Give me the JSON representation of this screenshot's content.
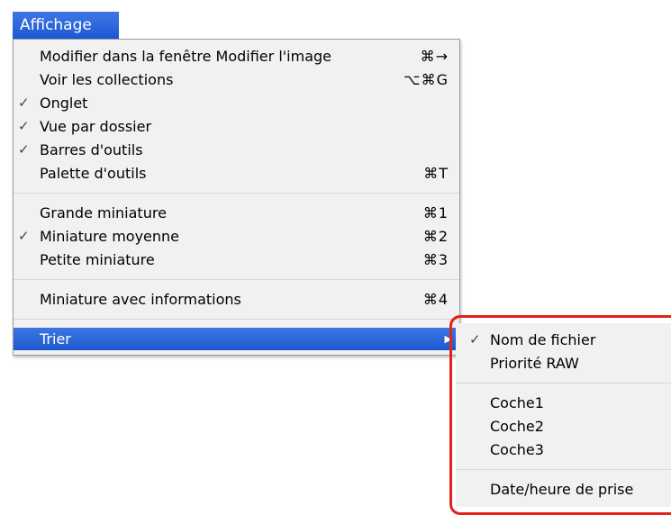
{
  "menu_title": "Affichage",
  "menu": {
    "items": [
      {
        "label": "Modifier dans la fenêtre Modifier l'image",
        "shortcut": "⌘→",
        "check": ""
      },
      {
        "label": "Voir les collections",
        "shortcut": "⌥⌘G",
        "check": ""
      },
      {
        "label": "Onglet",
        "shortcut": "",
        "check": "✓"
      },
      {
        "label": "Vue par dossier",
        "shortcut": "",
        "check": "✓"
      },
      {
        "label": "Barres d'outils",
        "shortcut": "",
        "check": "✓"
      },
      {
        "label": "Palette d'outils",
        "shortcut": "⌘T",
        "check": ""
      },
      {
        "label": "Grande miniature",
        "shortcut": "⌘1",
        "check": ""
      },
      {
        "label": "Miniature moyenne",
        "shortcut": "⌘2",
        "check": "✓"
      },
      {
        "label": "Petite miniature",
        "shortcut": "⌘3",
        "check": ""
      },
      {
        "label": "Miniature avec informations",
        "shortcut": "⌘4",
        "check": ""
      },
      {
        "label": "Trier",
        "shortcut": "▶",
        "check": ""
      }
    ]
  },
  "submenu": {
    "items": [
      {
        "label": "Nom de fichier",
        "check": "✓"
      },
      {
        "label": "Priorité RAW",
        "check": ""
      },
      {
        "label": "Coche1",
        "check": ""
      },
      {
        "label": "Coche2",
        "check": ""
      },
      {
        "label": "Coche3",
        "check": ""
      },
      {
        "label": "Date/heure de prise",
        "check": ""
      }
    ]
  },
  "colors": {
    "selection": "#1d58cf",
    "highlight_outline": "#e2231a"
  }
}
